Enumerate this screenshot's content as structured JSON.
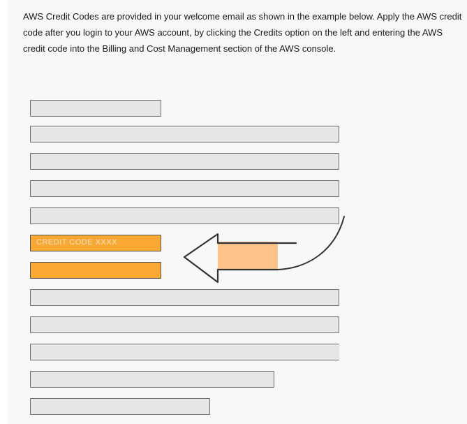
{
  "instructions": {
    "text": "AWS Credit Codes are provided in your welcome email as shown in the example below. Apply the AWS credit code after you login to your AWS account, by clicking the Credits option on the left and entering the AWS credit code into the Billing and Cost Management section of the AWS console."
  },
  "illustration": {
    "credit_code_label": "CREDIT CODE XXXX",
    "colors": {
      "highlight": "#f9a833",
      "arrow_fill": "#fcc48a",
      "placeholder_bar": "#e6e6e6"
    },
    "icons": [
      "curved-arrow-icon"
    ]
  }
}
